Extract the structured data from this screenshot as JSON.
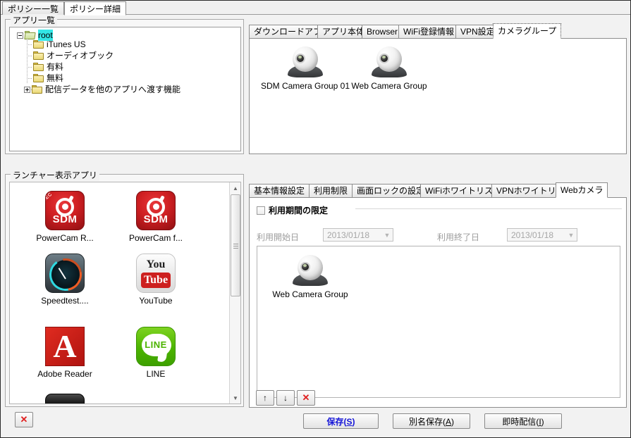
{
  "window": {
    "top_tabs": [
      {
        "label": "ポリシー一覧",
        "selected": false
      },
      {
        "label": "ポリシー詳細",
        "selected": true
      }
    ]
  },
  "app_list_group": {
    "title": "アプリ一覧",
    "tree": [
      {
        "label": "root",
        "level": 0,
        "expander": "minus",
        "folder": "open",
        "selected": true
      },
      {
        "label": "iTunes US",
        "level": 1,
        "expander": "none",
        "folder": "closed",
        "selected": false
      },
      {
        "label": "オーディオブック",
        "level": 1,
        "expander": "none",
        "folder": "closed",
        "selected": false
      },
      {
        "label": "有料",
        "level": 1,
        "expander": "none",
        "folder": "closed",
        "selected": false
      },
      {
        "label": "無料",
        "level": 1,
        "expander": "none",
        "folder": "closed",
        "selected": false
      },
      {
        "label": "配信データを他のアプリへ渡す機能",
        "level": 1,
        "expander": "plus",
        "folder": "closed",
        "selected": false
      }
    ]
  },
  "launcher_group": {
    "title": "ランチャー表示アプリ",
    "apps": [
      {
        "label": "PowerCam R...",
        "icon": "sdm-rec-icon"
      },
      {
        "label": "PowerCam f...",
        "icon": "sdm-icon"
      },
      {
        "label": "Speedtest....",
        "icon": "speedtest-icon"
      },
      {
        "label": "YouTube",
        "icon": "youtube-icon"
      },
      {
        "label": "Adobe Reader",
        "icon": "adobe-reader-icon"
      },
      {
        "label": "LINE",
        "icon": "line-icon"
      }
    ],
    "delete_button": {
      "icon": "red-x-icon",
      "label": "✕"
    },
    "scrollbar": {
      "up_arrow": "▲",
      "down_arrow": "▼",
      "thumb_top_pct": 4,
      "thumb_height_pct": 47
    }
  },
  "upper_right_panel": {
    "tabs": [
      {
        "label": "ダウンロードアプリ",
        "selected": false
      },
      {
        "label": "アプリ本体",
        "selected": false
      },
      {
        "label": "Browser",
        "selected": false
      },
      {
        "label": "WiFi登録情報",
        "selected": false
      },
      {
        "label": "VPN設定",
        "selected": false
      },
      {
        "label": "カメラグループ",
        "selected": true
      }
    ],
    "camera_groups": [
      {
        "label": "SDM Camera Group 01",
        "icon": "webcam-icon"
      },
      {
        "label": "Web Camera Group",
        "icon": "webcam-icon"
      }
    ]
  },
  "lower_right_panel": {
    "tabs": [
      {
        "label": "基本情報設定",
        "selected": false
      },
      {
        "label": "利用制限",
        "selected": false
      },
      {
        "label": "画面ロックの設定",
        "selected": false
      },
      {
        "label": "WiFiホワイトリスト",
        "selected": false
      },
      {
        "label": "VPNホワイトリスト",
        "selected": false
      },
      {
        "label": "Webカメラ",
        "selected": true
      }
    ],
    "period_checkbox": {
      "label": "利用期間の限定",
      "checked": false
    },
    "start_date": {
      "label": "利用開始日",
      "value": "2013/01/18",
      "disabled": true
    },
    "end_date": {
      "label": "利用終了日",
      "value": "2013/01/18",
      "disabled": true
    },
    "assigned_cameras": [
      {
        "label": "Web Camera Group",
        "icon": "webcam-icon"
      }
    ],
    "order_buttons": [
      {
        "name": "move-up-button",
        "glyph": "↑"
      },
      {
        "name": "move-down-button",
        "glyph": "↓"
      },
      {
        "name": "remove-button",
        "glyph": "✕"
      }
    ]
  },
  "footer": {
    "save": "保存(S)",
    "save_mnemonic": "S",
    "save_as": "別名保存(A)",
    "save_as_mnemonic": "A",
    "publish_now": "即時配信(I)",
    "publish_mnemonic": "I"
  },
  "colors": {
    "accent_blue": "#1414d8",
    "selection_cyan": "#33e6e6",
    "danger_red": "#e02020",
    "window_bg": "#f2f2f2"
  }
}
